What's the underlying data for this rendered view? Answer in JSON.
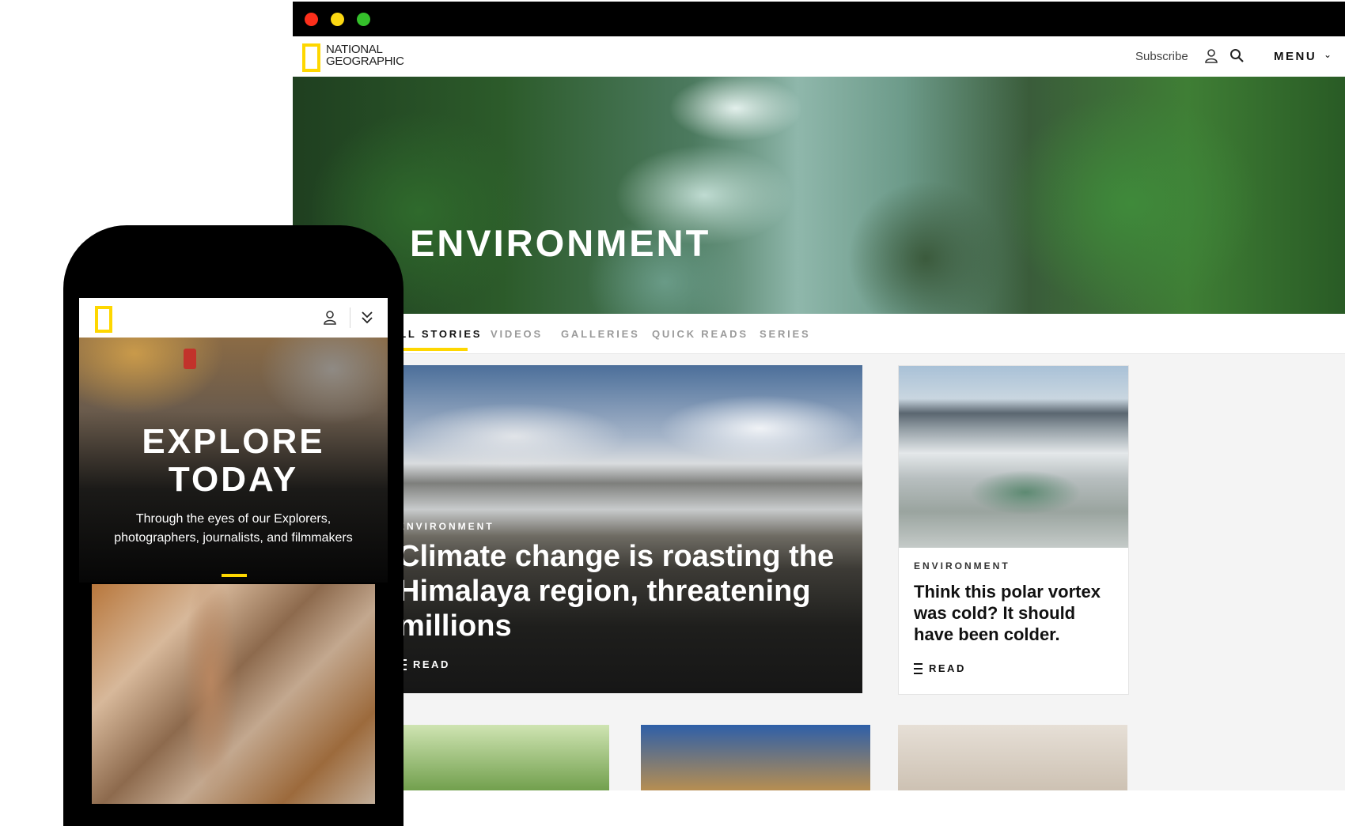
{
  "desktop": {
    "brand": {
      "line1": "NATIONAL",
      "line2": "GEOGRAPHIC"
    },
    "header": {
      "subscribe_label": "Subscribe",
      "menu_label": "MENU",
      "menu_chevron": "⌄"
    },
    "hero_title": "ENVIRONMENT",
    "tabs": [
      {
        "label": "ALL STORIES",
        "active": true
      },
      {
        "label": "VIDEOS",
        "active": false
      },
      {
        "label": "GALLERIES",
        "active": false
      },
      {
        "label": "QUICK READS",
        "active": false
      },
      {
        "label": "SERIES",
        "active": false
      }
    ],
    "main_story": {
      "kicker": "ENVIRONMENT",
      "headline": "Climate change is roasting the Himalaya region, threatening millions",
      "read_label": "READ"
    },
    "side_story": {
      "kicker": "ENVIRONMENT",
      "headline": "Think this polar vortex was cold? It should have been colder.",
      "read_label": "READ"
    }
  },
  "mobile": {
    "hero_title_line1": "EXPLORE",
    "hero_title_line2": "TODAY",
    "hero_subtitle": "Through the eyes of our Explorers, photographers, journalists, and filmmakers"
  },
  "colors": {
    "accent_yellow": "#fed700",
    "traffic_red": "#fd2f1b",
    "traffic_yellow": "#fbd812",
    "traffic_green": "#35c02b"
  },
  "icons": [
    "user-icon",
    "search-icon",
    "chevron-down-icon",
    "read-lines-icon",
    "logo-rectangle-icon"
  ]
}
